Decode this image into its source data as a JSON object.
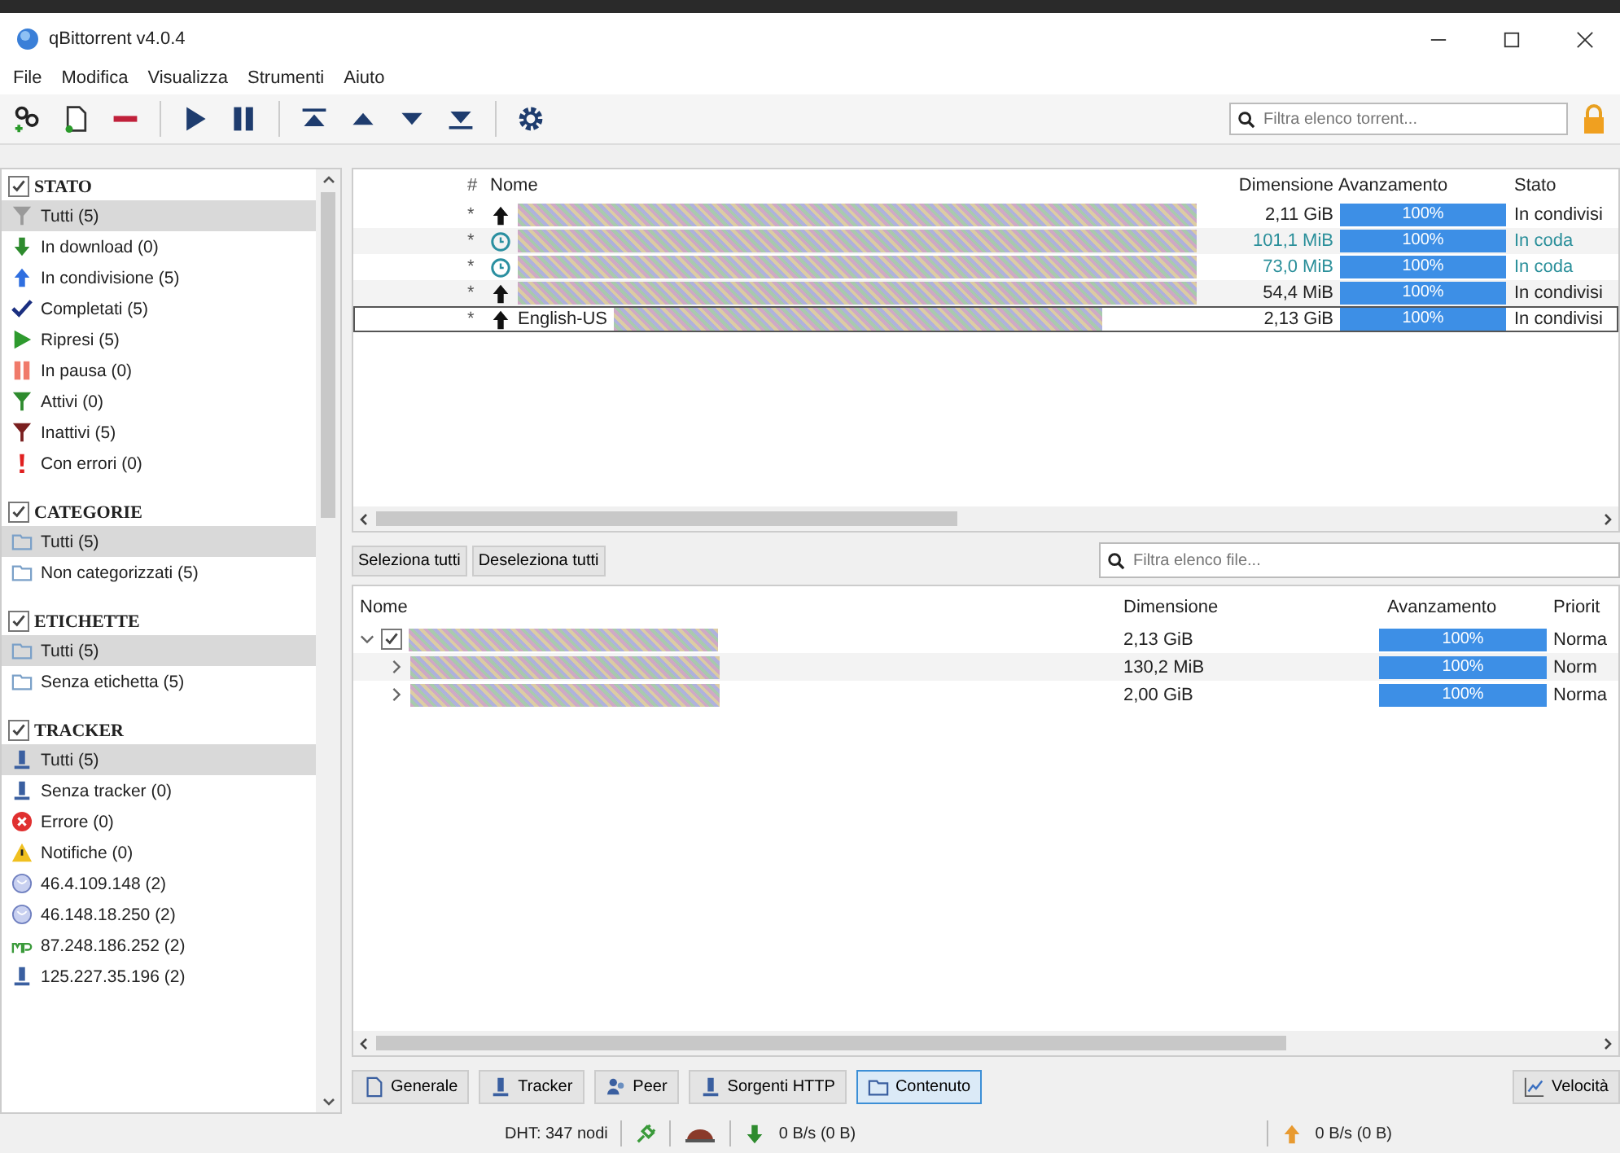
{
  "window": {
    "title": "qBittorrent v4.0.4"
  },
  "menu": [
    "File",
    "Modifica",
    "Visualizza",
    "Strumenti",
    "Aiuto"
  ],
  "toolbar": {
    "buttons": [
      {
        "kind": "add-link"
      },
      {
        "kind": "add-file"
      },
      {
        "kind": "remove"
      },
      {
        "kind": "sep"
      },
      {
        "kind": "resume"
      },
      {
        "kind": "pause"
      },
      {
        "kind": "sep"
      },
      {
        "kind": "top"
      },
      {
        "kind": "up"
      },
      {
        "kind": "down"
      },
      {
        "kind": "bottom"
      },
      {
        "kind": "sep"
      },
      {
        "kind": "settings"
      }
    ],
    "search": {
      "placeholder": "Filtra elenco torrent..."
    }
  },
  "sidebar": {
    "sections": [
      {
        "title": "STATO",
        "checked": true,
        "items": [
          {
            "label": "Tutti (5)",
            "kind": "filter-grey",
            "selected": true
          },
          {
            "label": "In download (0)",
            "kind": "down-green",
            "selected": false
          },
          {
            "label": "In condivisione (5)",
            "kind": "up-blue",
            "selected": false
          },
          {
            "label": "Completati (5)",
            "kind": "check",
            "selected": false
          },
          {
            "label": "Ripresi (5)",
            "kind": "play",
            "selected": false
          },
          {
            "label": "In pausa (0)",
            "kind": "pause",
            "selected": false
          },
          {
            "label": "Attivi (0)",
            "kind": "filter-green",
            "selected": false
          },
          {
            "label": "Inattivi (5)",
            "kind": "filter-red",
            "selected": false
          },
          {
            "label": "Con errori (0)",
            "kind": "error",
            "selected": false
          }
        ]
      },
      {
        "title": "CATEGORIE",
        "checked": true,
        "items": [
          {
            "label": "Tutti (5)",
            "kind": "folder",
            "selected": true
          },
          {
            "label": "Non categorizzati (5)",
            "kind": "folder",
            "selected": false
          }
        ]
      },
      {
        "title": "ETICHETTE",
        "checked": true,
        "items": [
          {
            "label": "Tutti (5)",
            "kind": "folder",
            "selected": true
          },
          {
            "label": "Senza etichetta (5)",
            "kind": "folder",
            "selected": false
          }
        ]
      },
      {
        "title": "TRACKER",
        "checked": true,
        "items": [
          {
            "label": "Tutti (5)",
            "kind": "server",
            "selected": true
          },
          {
            "label": "Senza tracker (0)",
            "kind": "server",
            "selected": false
          },
          {
            "label": "Errore (0)",
            "kind": "x-red",
            "selected": false
          },
          {
            "label": "Notifiche (0)",
            "kind": "warning",
            "selected": false
          },
          {
            "label": "46.4.109.148 (2)",
            "kind": "globe",
            "selected": false
          },
          {
            "label": "46.148.18.250 (2)",
            "kind": "globe",
            "selected": false
          },
          {
            "label": "87.248.186.252 (2)",
            "kind": "mp",
            "selected": false
          },
          {
            "label": "125.227.35.196 (2)",
            "kind": "server",
            "selected": false
          }
        ]
      }
    ]
  },
  "torrents": {
    "columns": [
      "#",
      "Nome",
      "Dimensione",
      "Avanzamento",
      "Stato"
    ],
    "rows": [
      {
        "priority": "*",
        "kind": "seeding",
        "size": "2,11 GiB",
        "level": 1,
        "progress": "100%",
        "state": "In condivisi",
        "selected": false
      },
      {
        "priority": "*",
        "kind": "queued",
        "size": "101,1 MiB",
        "level": 1,
        "progress": "100%",
        "state": "In coda",
        "selected": false
      },
      {
        "priority": "*",
        "kind": "queued",
        "size": "73,0 MiB",
        "level": 1,
        "progress": "100%",
        "state": "In coda",
        "selected": false
      },
      {
        "priority": "*",
        "kind": "seeding",
        "size": "54,4 MiB",
        "level": 1,
        "progress": "100%",
        "state": "In condivisi",
        "selected": false
      },
      {
        "priority": "*",
        "kind": "seeding",
        "name": "English-US",
        "size": "2,13 GiB",
        "level": 1,
        "progress": "100%",
        "state": "In condivisi",
        "selected": true
      }
    ]
  },
  "content": {
    "buttons": [
      "Seleziona tutti",
      "Deseleziona tutti"
    ],
    "search": {
      "placeholder": "Filtra elenco file..."
    },
    "columns": [
      "Nome",
      "Dimensione",
      "Avanzamento",
      "Priorit"
    ],
    "rows": [
      {
        "expanded": true,
        "checked": true,
        "size": "2,13 GiB",
        "level": 1,
        "progress": "100%",
        "priority": "Norma",
        "children": [
          {
            "expanded": false,
            "size": "130,2 MiB",
            "level": 1,
            "progress": "100%",
            "priority": "Norm"
          },
          {
            "expanded": false,
            "size": "2,00 GiB",
            "level": 1,
            "progress": "100%",
            "priority": "Norma"
          }
        ]
      }
    ]
  },
  "tabs": [
    {
      "label": "Generale",
      "kind": "doc",
      "selected": false
    },
    {
      "label": "Tracker",
      "kind": "server",
      "selected": false
    },
    {
      "label": "Peer",
      "kind": "people",
      "selected": false
    },
    {
      "label": "Sorgenti HTTP",
      "kind": "server",
      "selected": false
    },
    {
      "label": "Contenuto",
      "kind": "folder",
      "selected": true
    }
  ],
  "speed_button": "Velocità",
  "status_bar": {
    "dht": "DHT: 347 nodi",
    "download": "0 B/s (0 B)",
    "upload": "0 B/s (0 B)"
  }
}
